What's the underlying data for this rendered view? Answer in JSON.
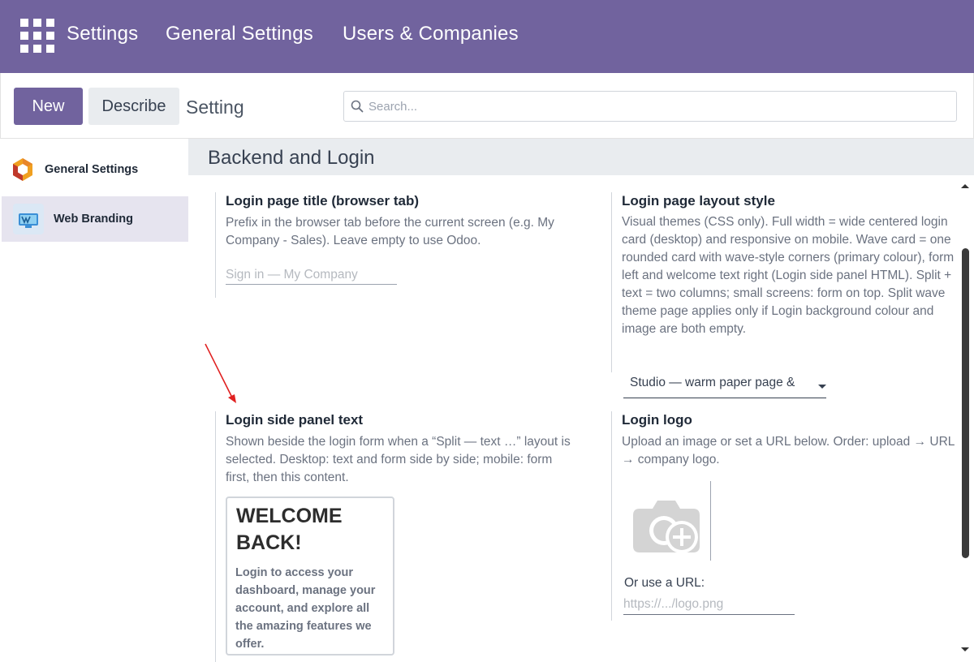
{
  "navbar": {
    "apps_icon": "apps-grid-icon",
    "app_name": "Settings",
    "menu": [
      "General Settings",
      "Users & Companies"
    ]
  },
  "control_panel": {
    "new_label": "New",
    "describe_label": "Describe",
    "title": "Setting",
    "search_placeholder": "Search...",
    "search_icon": "search-icon"
  },
  "sidebar": {
    "items": [
      {
        "label": "General Settings",
        "icon": "odoo-logo-icon",
        "active": false
      },
      {
        "label": "Web Branding",
        "icon": "web-branding-icon",
        "active": true
      }
    ]
  },
  "content": {
    "section_title": "Backend and Login",
    "settings": {
      "login_title": {
        "title": "Login page title (browser tab)",
        "description": "Prefix in the browser tab before the current screen (e.g. My Company - Sales). Leave empty to use Odoo.",
        "field_value": "",
        "field_placeholder": "Sign in — My Company"
      },
      "layout_style": {
        "title": "Login page layout style",
        "description": "Visual themes (CSS only). Full width = wide centered login card (desktop) and responsive on mobile. Wave card = one rounded card with wave-style corners (primary colour), form left and welcome text right (Login side panel HTML). Split + text = two columns; small screens: form on top. Split wave theme page applies only if Login background colour and image are both empty.",
        "selected": "Studio — warm paper page &"
      },
      "side_panel": {
        "title": "Login side panel text",
        "description": "Shown beside the login form when a “Split — text …” layout is selected. Desktop: text and form side by side; mobile: form first, then this content.",
        "welcome_heading": "WELCOME BACK!",
        "welcome_text": "Login to access your dashboard, manage your account, and explore all the amazing features we offer."
      },
      "login_logo": {
        "title": "Login logo",
        "description": "Upload an image or set a URL below. Order: upload → URL → company logo.",
        "upload_icon": "camera-add-icon",
        "url_label": "Or use a URL:",
        "url_placeholder": "https://.../logo.png"
      }
    }
  },
  "colors": {
    "brand": "#71639e",
    "active_sidebar": "#e6e4ef",
    "section_header": "#e9ecef",
    "annotation_arrow": "#e02020"
  }
}
